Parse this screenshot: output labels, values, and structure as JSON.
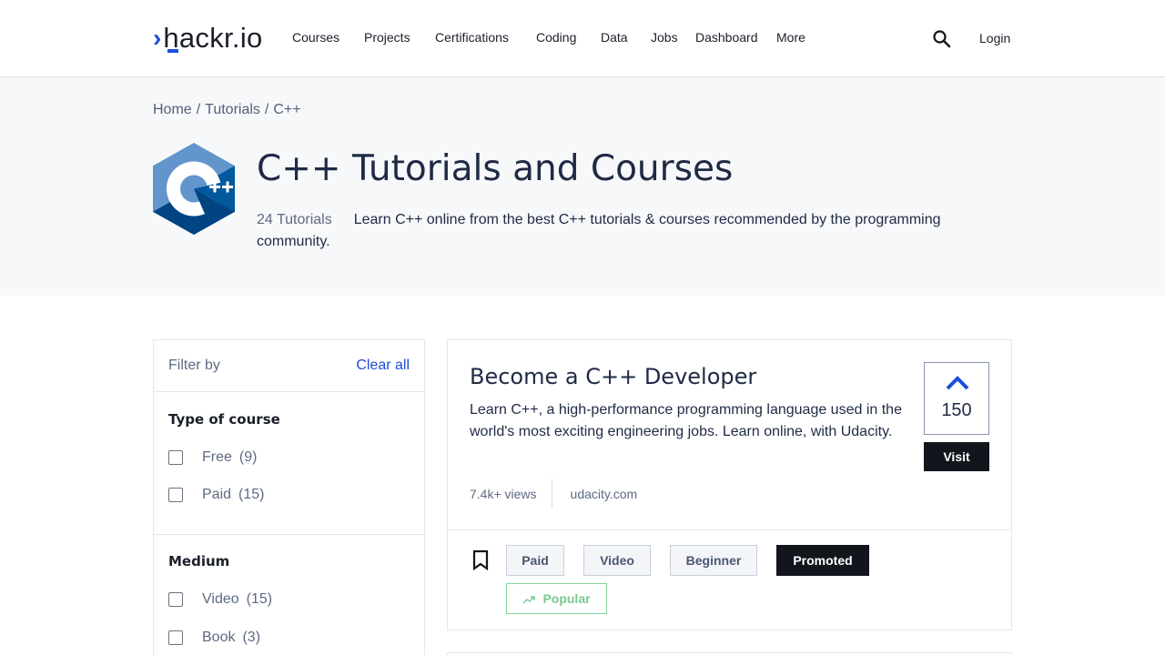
{
  "header": {
    "logo_text": "hackr.io",
    "nav": [
      {
        "label": "Courses"
      },
      {
        "label": "Projects"
      },
      {
        "label": "Certifications"
      },
      {
        "label": "Coding"
      },
      {
        "label": "Data"
      },
      {
        "label": "Jobs"
      },
      {
        "label": "Dashboard"
      },
      {
        "label": "More"
      }
    ],
    "search_icon": "search-icon",
    "login_label": "Login"
  },
  "breadcrumb": {
    "home": "Home",
    "tutorials": "Tutorials",
    "current": "C++"
  },
  "hero": {
    "title": "C++ Tutorials and Courses",
    "count": "24 Tutorials",
    "description": "Learn C++ online from the best C++ tutorials & courses recommended by the programming community."
  },
  "filter": {
    "title": "Filter by",
    "clear_all": "Clear all",
    "sections": [
      {
        "title": "Type of course",
        "options": [
          {
            "label": "Free",
            "count": "(9)"
          },
          {
            "label": "Paid",
            "count": "(15)"
          }
        ]
      },
      {
        "title": "Medium",
        "options": [
          {
            "label": "Video",
            "count": "(15)"
          },
          {
            "label": "Book",
            "count": "(3)"
          }
        ]
      }
    ]
  },
  "course": {
    "title": "Become a C++ Developer",
    "description": "Learn C++, a high-performance programming language used in the world's most exciting engineering jobs. Learn online, with Udacity.",
    "views": "7.4k+ views",
    "domain": "udacity.com",
    "upvotes": "150",
    "visit_label": "Visit",
    "tags": [
      "Paid",
      "Video",
      "Beginner",
      "Promoted"
    ],
    "popular_label": "Popular"
  },
  "colors": {
    "accent": "#1d4ed8",
    "dark": "#12151c",
    "popular": "#7cc98e"
  }
}
